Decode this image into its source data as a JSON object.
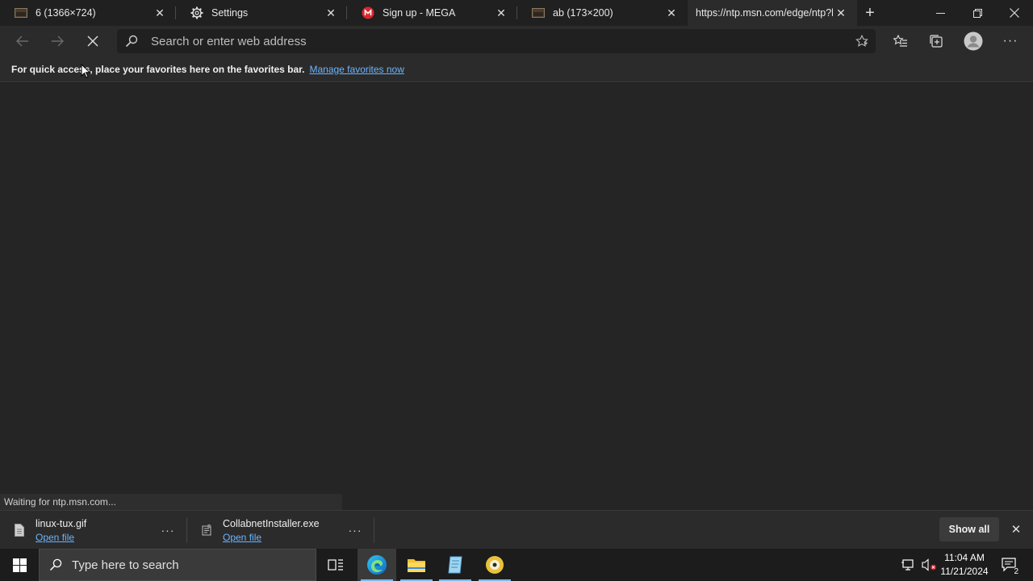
{
  "tabs": [
    {
      "title": "6 (1366×724)",
      "icon": "image-thumbnail-icon"
    },
    {
      "title": "Settings",
      "icon": "gear-icon"
    },
    {
      "title": "Sign up - MEGA",
      "icon": "mega-logo-icon"
    },
    {
      "title": "ab (173×200)",
      "icon": "image-thumbnail-icon"
    },
    {
      "title": "https://ntp.msn.com/edge/ntp?l",
      "icon": "none",
      "active": true
    }
  ],
  "toolbar": {
    "address_placeholder": "Search or enter web address"
  },
  "favorites_bar": {
    "message": "For quick access, place your favorites here on the favorites bar.",
    "link": "Manage favorites now"
  },
  "status_text": "Waiting for ntp.msn.com...",
  "downloads": {
    "items": [
      {
        "file": "linux-tux.gif",
        "action": "Open file"
      },
      {
        "file": "CollabnetInstaller.exe",
        "action": "Open file"
      }
    ],
    "show_all": "Show all"
  },
  "taskbar": {
    "search_placeholder": "Type here to search",
    "time": "11:04 AM",
    "date": "11/21/2024",
    "notification_count": "2"
  },
  "colors": {
    "link": "#6cb4ff",
    "background": "#202020",
    "taskbar_accent": "#76b9ed"
  }
}
